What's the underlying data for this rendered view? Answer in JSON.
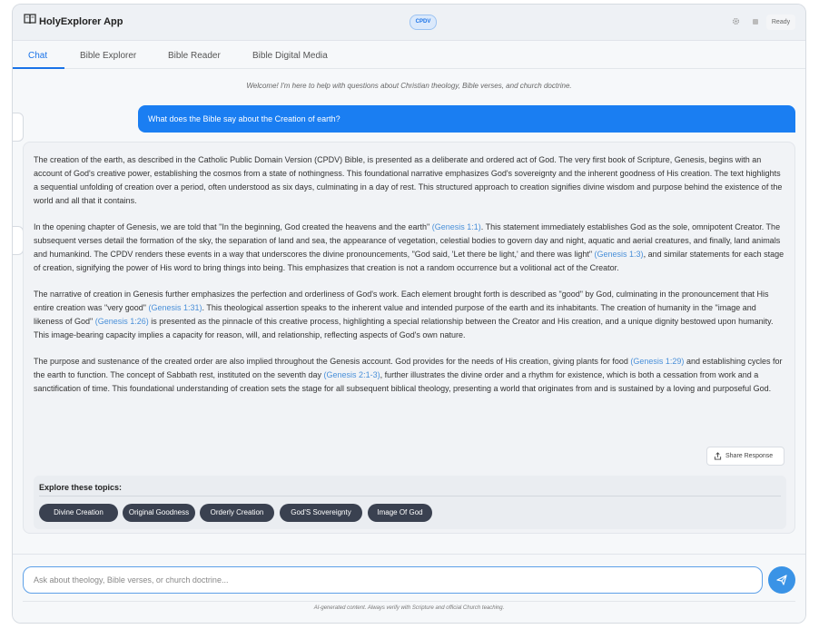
{
  "header": {
    "app_title": "HolyExplorer App",
    "version_badge": "CPDV",
    "status": "Ready"
  },
  "tabs": [
    {
      "label": "Chat",
      "active": true
    },
    {
      "label": "Bible Explorer",
      "active": false
    },
    {
      "label": "Bible Reader",
      "active": false
    },
    {
      "label": "Bible Digital Media",
      "active": false
    }
  ],
  "chat": {
    "welcome": "Welcome! I'm here to help with questions about Christian theology, Bible verses, and church doctrine.",
    "user_message": "What does the Bible say about the Creation of earth?",
    "response": {
      "p1": "The creation of the earth, as described in the Catholic Public Domain Version (CPDV) Bible, is presented as a deliberate and ordered act of God. The very first book of Scripture, Genesis, begins with an account of God's creative power, establishing the cosmos from a state of nothingness. This foundational narrative emphasizes God's sovereignty and the inherent goodness of His creation. The text highlights a sequential unfolding of creation over a period, often understood as six days, culminating in a day of rest. This structured approach to creation signifies divine wisdom and purpose behind the existence of the world and all that it contains.",
      "p2a": "In the opening chapter of Genesis, we are told that \"In the beginning, God created the heavens and the earth\" ",
      "p2_ref1": "(Genesis 1:1)",
      "p2b": ". This statement immediately establishes God as the sole, omnipotent Creator. The subsequent verses detail the formation of the sky, the separation of land and sea, the appearance of vegetation, celestial bodies to govern day and night, aquatic and aerial creatures, and finally, land animals and humankind. The CPDV renders these events in a way that underscores the divine pronouncements, \"God said, 'Let there be light,' and there was light\" ",
      "p2_ref2": "(Genesis 1:3)",
      "p2c": ", and similar statements for each stage of creation, signifying the power of His word to bring things into being. This emphasizes that creation is not a random occurrence but a volitional act of the Creator.",
      "p3a": "The narrative of creation in Genesis further emphasizes the perfection and orderliness of God's work. Each element brought forth is described as \"good\" by God, culminating in the pronouncement that His entire creation was \"very good\" ",
      "p3_ref1": "(Genesis 1:31)",
      "p3b": ". This theological assertion speaks to the inherent value and intended purpose of the earth and its inhabitants. The creation of humanity in the \"image and likeness of God\" ",
      "p3_ref2": "(Genesis 1:26)",
      "p3c": " is presented as the pinnacle of this creative process, highlighting a special relationship between the Creator and His creation, and a unique dignity bestowed upon humanity. This image-bearing capacity implies a capacity for reason, will, and relationship, reflecting aspects of God's own nature.",
      "p4a": "The purpose and sustenance of the created order are also implied throughout the Genesis account. God provides for the needs of His creation, giving plants for food ",
      "p4_ref1": "(Genesis 1:29)",
      "p4b": " and establishing cycles for the earth to function. The concept of Sabbath rest, instituted on the seventh day ",
      "p4_ref2": "(Genesis 2:1-3)",
      "p4c": ", further illustrates the divine order and a rhythm for existence, which is both a cessation from work and a sanctification of time. This foundational understanding of creation sets the stage for all subsequent biblical theology, presenting a world that originates from and is sustained by a loving and purposeful God."
    },
    "share_label": "Share Response",
    "topics_title": "Explore these topics:",
    "topics": [
      "Divine Creation",
      "Original Goodness",
      "Orderly Creation",
      "God'S Sovereignty",
      "Image Of God"
    ]
  },
  "composer": {
    "placeholder": "Ask about theology, Bible verses, or church doctrine...",
    "disclaimer": "AI-generated content. Always verify with Scripture and official Church teaching."
  },
  "colors": {
    "accent": "#1a7ef2",
    "chip_bg": "#3a4150",
    "reference_link": "#4a90d9"
  }
}
